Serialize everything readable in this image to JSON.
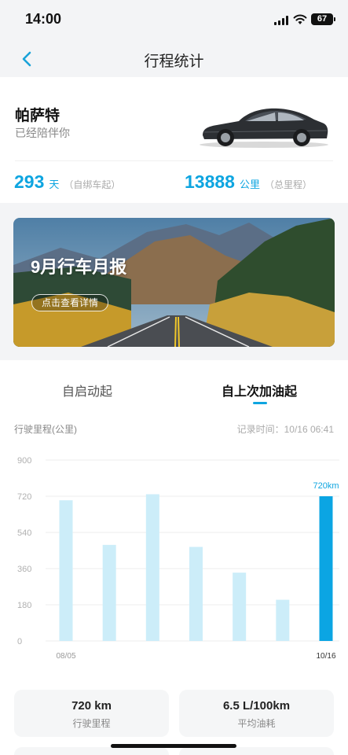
{
  "status_bar": {
    "time": "14:00",
    "battery": "67"
  },
  "nav": {
    "title": "行程统计"
  },
  "car": {
    "name": "帕萨特",
    "subtitle": "已经陪伴你",
    "days": "293",
    "days_unit": "天",
    "days_note": "（自绑车起）",
    "km": "13888",
    "km_unit": "公里",
    "km_note": "（总里程）"
  },
  "banner": {
    "title": "9月行车月报",
    "button": "点击查看详情"
  },
  "tabs": [
    {
      "label": "自启动起",
      "active": false
    },
    {
      "label": "自上次加油起",
      "active": true
    }
  ],
  "chart_header": {
    "label": "行驶里程(公里)",
    "record_time": "记录时间：10/16 06:41"
  },
  "chart_data": {
    "type": "bar",
    "ylabel": "行驶里程(公里)",
    "ylim": [
      0,
      900
    ],
    "yticks": [
      "900",
      "720",
      "540",
      "360",
      "180",
      "0"
    ],
    "categories": [
      "08/05",
      "",
      "",
      "",
      "",
      "",
      "10/16"
    ],
    "values": [
      700,
      478,
      730,
      468,
      340,
      205,
      720
    ],
    "highlight_index": 6,
    "highlight_label": "720km",
    "colors": {
      "bar": "#ccedf9",
      "highlight": "#0ba5e3"
    },
    "grid": true
  },
  "summary": [
    {
      "value": "720 km",
      "label": "行驶里程"
    },
    {
      "value": "6.5 L/100km",
      "label": "平均油耗"
    }
  ],
  "colors": {
    "accent": "#0ea5e0",
    "page_bg": "#f3f4f6"
  }
}
